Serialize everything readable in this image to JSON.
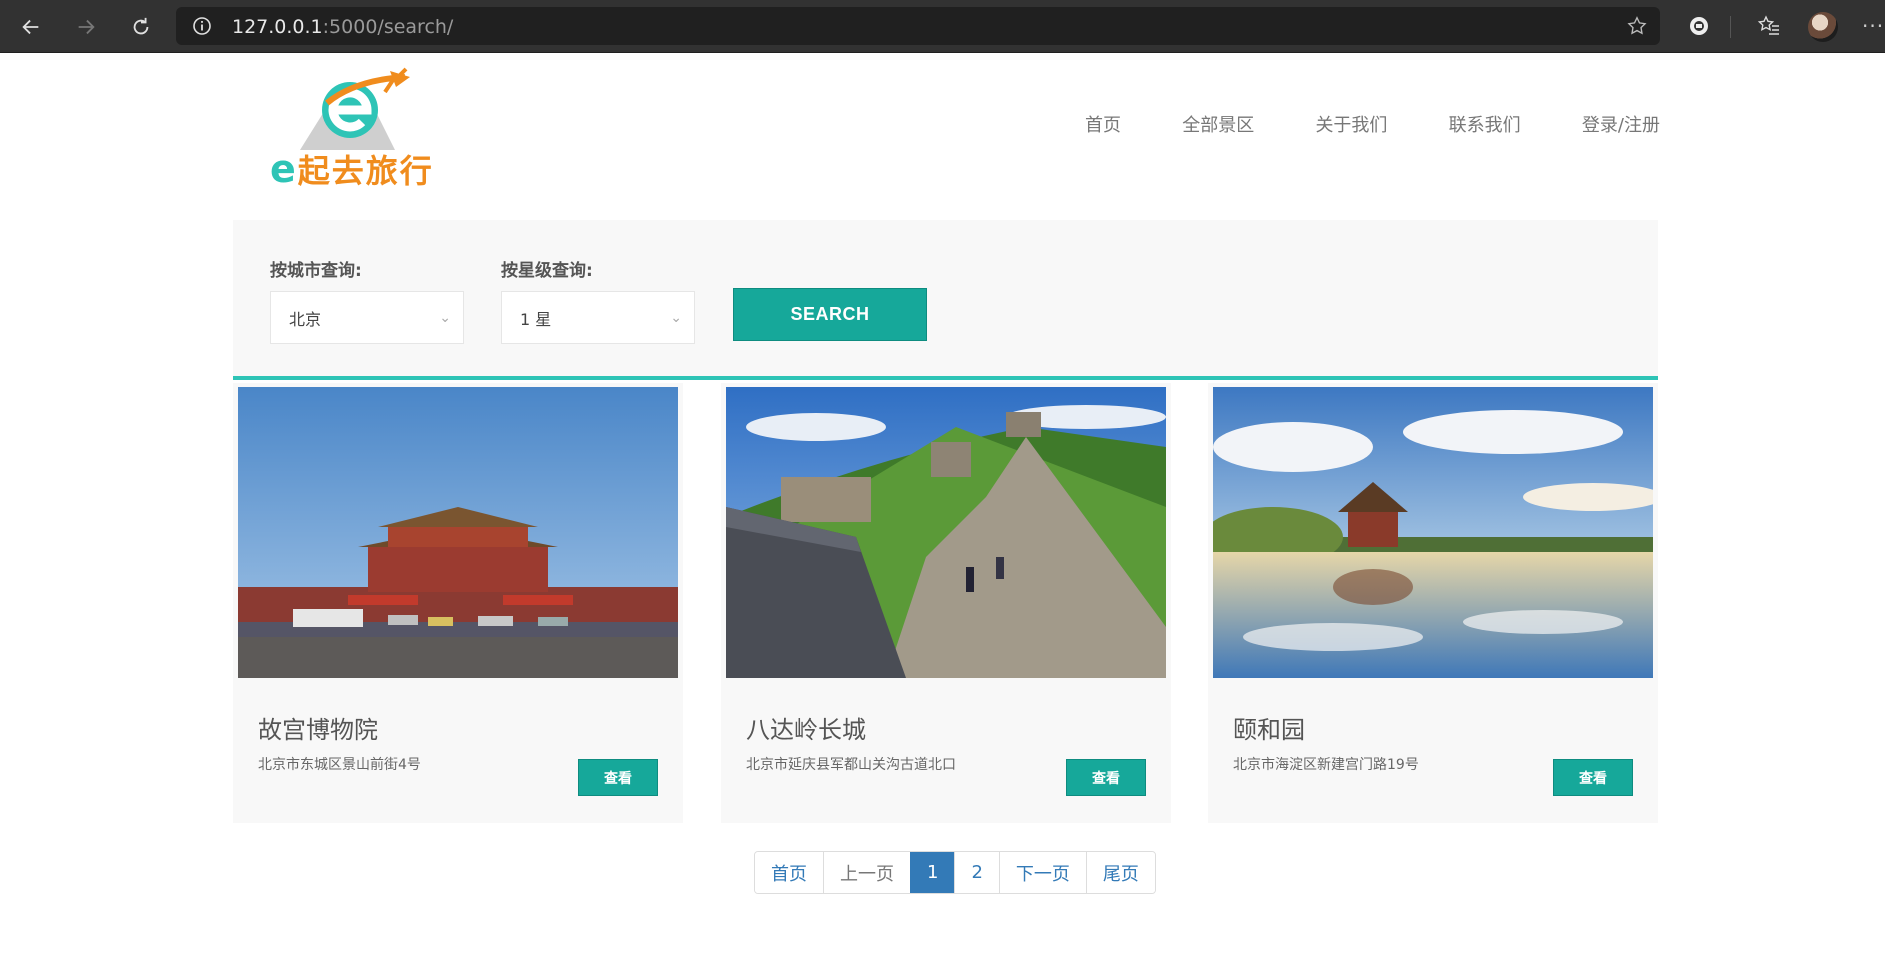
{
  "browser": {
    "url_host": "127.0.0.1",
    "url_path": ":5000/search/",
    "icons": [
      "back-arrow-icon",
      "forward-arrow-icon",
      "reload-icon",
      "info-icon",
      "star-icon",
      "extension-icon",
      "favorites-icon",
      "avatar",
      "more-icon"
    ]
  },
  "logo": {
    "letter": "e",
    "text": "起去旅行",
    "colors": {
      "teal": "#2ec4b6",
      "orange": "#f08c1d"
    }
  },
  "nav": {
    "items": [
      "首页",
      "全部景区",
      "关于我们",
      "联系我们",
      "登录/注册"
    ]
  },
  "search": {
    "city_label": "按城市查询:",
    "city_value": "北京",
    "star_label": "按星级查询:",
    "star_value": "1 星",
    "button_label": "SEARCH"
  },
  "cards": [
    {
      "title": "故宫博物院",
      "address": "北京市东城区景山前街4号",
      "button": "查看"
    },
    {
      "title": "八达岭长城",
      "address": "北京市延庆县军都山关沟古道北口",
      "button": "查看"
    },
    {
      "title": "颐和园",
      "address": "北京市海淀区新建宫门路19号",
      "button": "查看"
    }
  ],
  "pagination": {
    "items": [
      "首页",
      "上一页",
      "1",
      "2",
      "下一页",
      "尾页"
    ],
    "active": "1"
  },
  "colors": {
    "accent": "#16a89a",
    "accent_line": "#2ec4b6",
    "pagination_active": "#337ab7"
  }
}
